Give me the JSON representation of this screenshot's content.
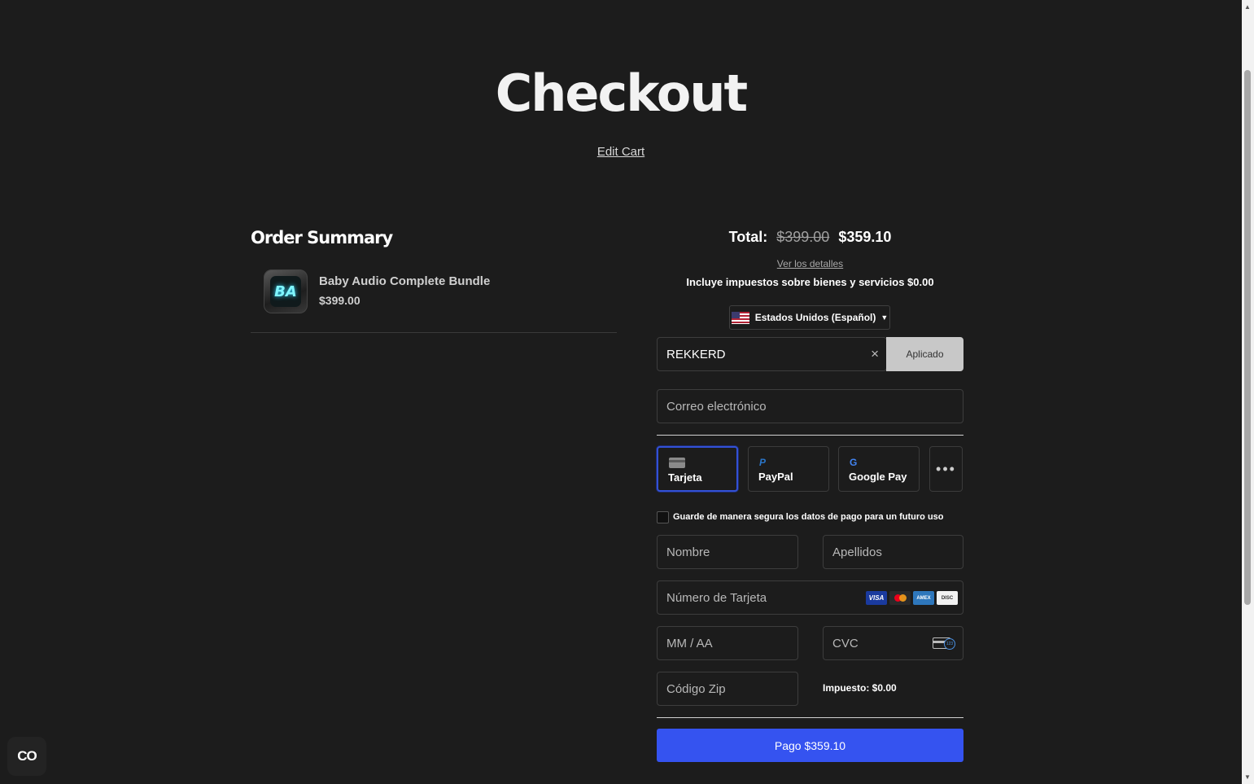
{
  "header": {
    "title": "Checkout",
    "edit_cart": "Edit Cart"
  },
  "order_summary": {
    "title": "Order Summary",
    "items": [
      {
        "thumb_text": "BA",
        "name": "Baby Audio Complete Bundle",
        "price": "$399.00"
      }
    ]
  },
  "payment": {
    "total_label": "Total:",
    "total_original": "$399.00",
    "total_discounted": "$359.10",
    "details_link": "Ver los detalles",
    "tax_note": "Incluye impuestos sobre bienes y servicios $0.00",
    "locale": "Estados Unidos (Español)",
    "coupon_value": "REKKERD",
    "coupon_clear_icon": "×",
    "apply_label": "Aplicado",
    "email_placeholder": "Correo electrónico",
    "methods": [
      {
        "label": "Tarjeta",
        "icon": "card-icon",
        "active": true
      },
      {
        "label": "PayPal",
        "icon": "paypal-icon",
        "active": false
      },
      {
        "label": "Google Pay",
        "icon": "google-icon",
        "active": false
      }
    ],
    "more_icon": "•••",
    "save_label": "Guarde de manera segura los datos de pago para un futuro uso",
    "first_name_placeholder": "Nombre",
    "last_name_placeholder": "Apellidos",
    "card_number_placeholder": "Número de Tarjeta",
    "card_brands": [
      "VISA",
      "",
      "AMERICAN EXPRESS",
      "DISCOVER"
    ],
    "expiry_placeholder": "MM / AA",
    "cvc_placeholder": "CVC",
    "cvc_badge": "123",
    "zip_placeholder": "Código Zip",
    "tax_line": "Impuesto: $0.00",
    "pay_button": "Pago $359.10"
  },
  "widget": {
    "accessibility_label": "CO"
  },
  "colors": {
    "background": "#1c1c1c",
    "accent": "#3553f0",
    "active_border": "#3351d6"
  }
}
